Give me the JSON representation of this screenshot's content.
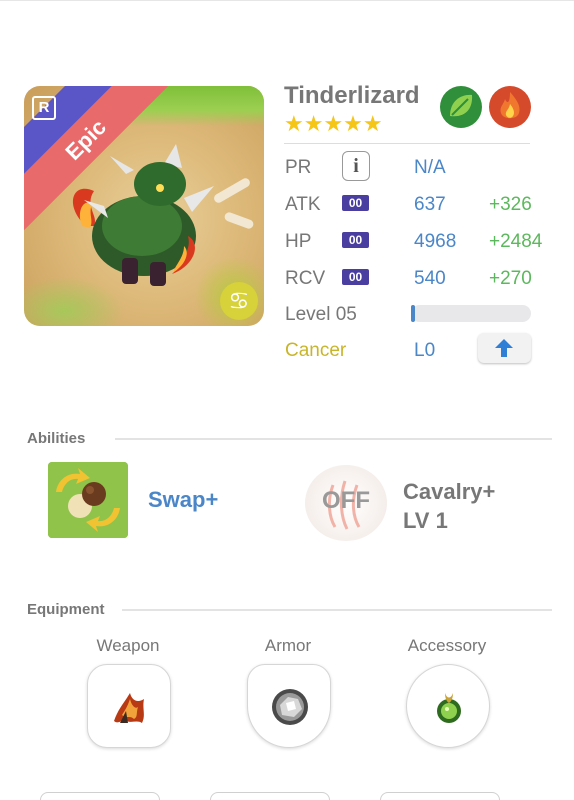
{
  "card": {
    "badge_letter": "R",
    "rarity_label": "Epic",
    "zodiac_glyph": "♋"
  },
  "monster": {
    "name": "Tinderlizard",
    "stars": "★★★★★",
    "elements": [
      "leaf-element-icon",
      "fire-element-icon"
    ]
  },
  "stats": {
    "pr": {
      "label": "PR",
      "info_glyph": "i",
      "value": "N/A"
    },
    "atk": {
      "label": "ATK",
      "badge": "00",
      "value": "637",
      "bonus": "+326"
    },
    "hp": {
      "label": "HP",
      "badge": "00",
      "value": "4968",
      "bonus": "+2484"
    },
    "rcv": {
      "label": "RCV",
      "badge": "00",
      "value": "540",
      "bonus": "+270"
    },
    "level": {
      "label": "Level 05",
      "progress": 0.01
    },
    "zodiac": {
      "label": "Cancer",
      "value": "L0"
    }
  },
  "abilities": {
    "title": "Abilities",
    "active": {
      "name": "Swap+"
    },
    "passive": {
      "state": "OFF",
      "name_line1": "Cavalry+",
      "name_line2": "LV 1"
    }
  },
  "equipment": {
    "title": "Equipment",
    "slots": [
      {
        "label": "Weapon"
      },
      {
        "label": "Armor"
      },
      {
        "label": "Accessory"
      }
    ]
  },
  "colors": {
    "accent_blue": "#4a86c8",
    "bonus_green": "#5cb85c",
    "star_yellow": "#f5c518",
    "zodiac_gold": "#c9b52a",
    "epic_ribbon": "#e96a6a"
  }
}
